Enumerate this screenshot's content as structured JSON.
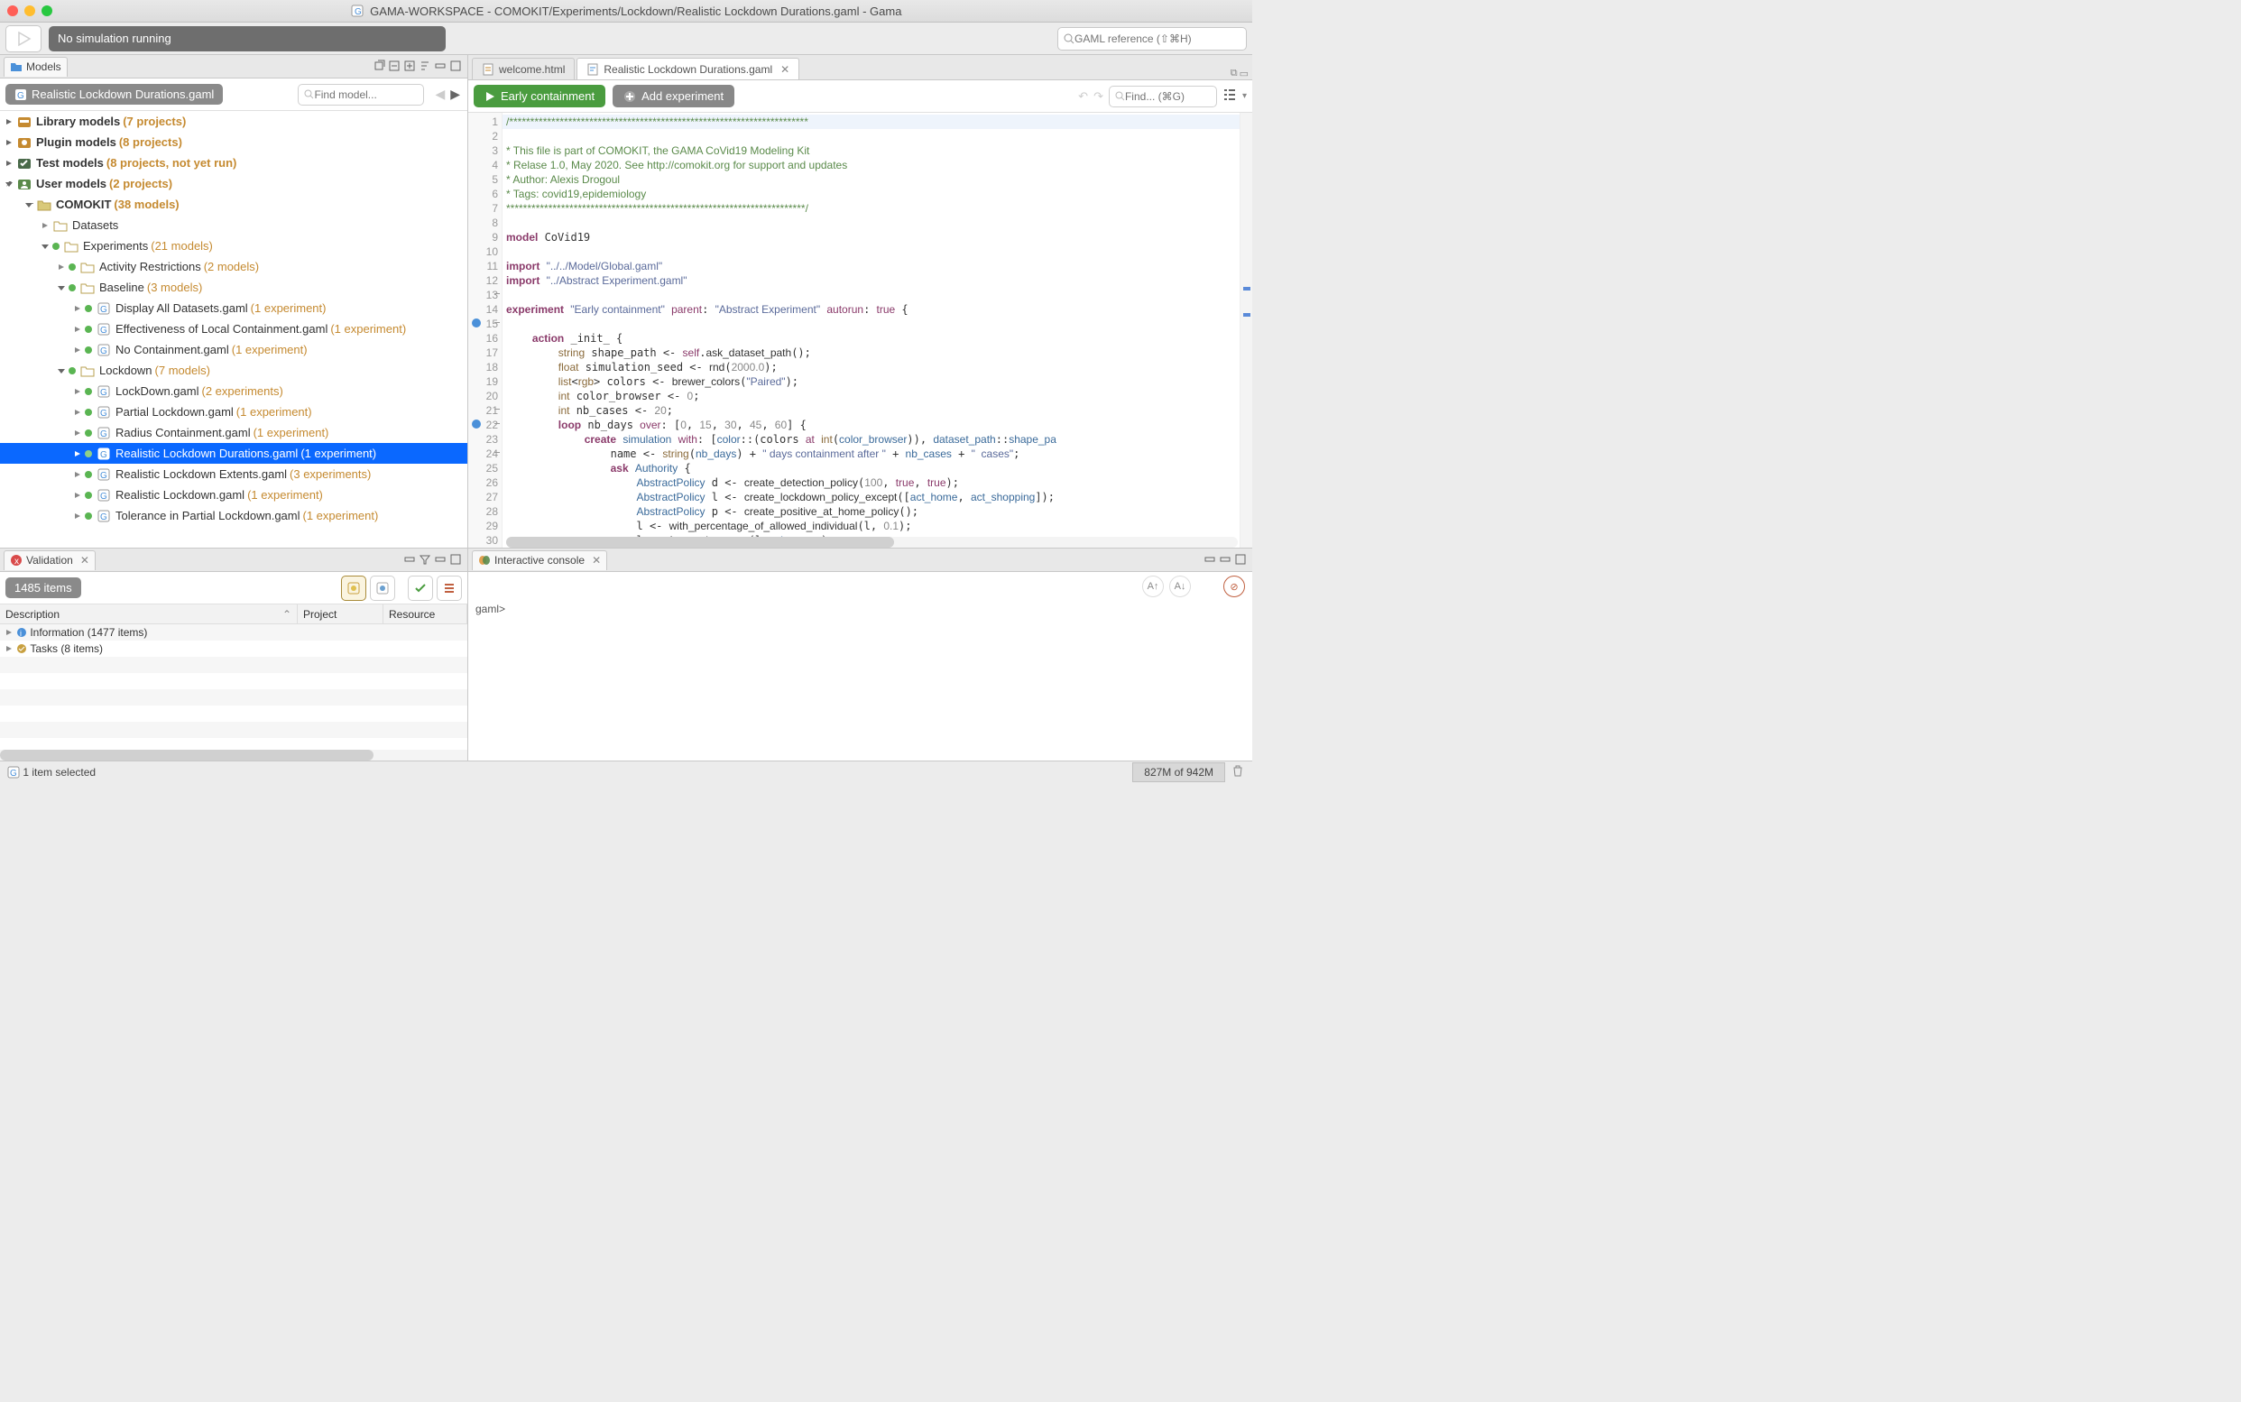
{
  "title": "GAMA-WORKSPACE - COMOKIT/Experiments/Lockdown/Realistic Lockdown Durations.gaml - Gama",
  "simStatus": "No simulation running",
  "searchPlaceholder": "GAML reference (⇧⌘H)",
  "modelsTab": "Models",
  "breadcrumb": "Realistic Lockdown Durations.gaml",
  "findModelPlaceholder": "Find model...",
  "tree": {
    "lib": {
      "label": "Library models",
      "count": "(7 projects)"
    },
    "plugin": {
      "label": "Plugin models",
      "count": "(8 projects)"
    },
    "test": {
      "label": "Test models",
      "count": "(8 projects, not yet run)"
    },
    "user": {
      "label": "User models",
      "count": "(2 projects)"
    },
    "comokit": {
      "label": "COMOKIT",
      "count": "(38 models)"
    },
    "datasets": {
      "label": "Datasets"
    },
    "experiments": {
      "label": "Experiments",
      "count": "(21 models)"
    },
    "activity": {
      "label": "Activity Restrictions",
      "count": "(2 models)"
    },
    "baseline": {
      "label": "Baseline",
      "count": "(3 models)"
    },
    "displayAll": {
      "label": "Display All Datasets.gaml",
      "count": "(1 experiment)"
    },
    "effectiveness": {
      "label": "Effectiveness of Local Containment.gaml",
      "count": "(1 experiment)"
    },
    "noContain": {
      "label": "No Containment.gaml",
      "count": "(1 experiment)"
    },
    "lockdown": {
      "label": "Lockdown",
      "count": "(7 models)"
    },
    "lockdownG": {
      "label": "LockDown.gaml",
      "count": "(2 experiments)"
    },
    "partial": {
      "label": "Partial Lockdown.gaml",
      "count": "(1 experiment)"
    },
    "radius": {
      "label": "Radius Containment.gaml",
      "count": "(1 experiment)"
    },
    "realisticDur": {
      "label": "Realistic Lockdown Durations.gaml",
      "count": "(1 experiment)"
    },
    "realisticExt": {
      "label": "Realistic Lockdown Extents.gaml",
      "count": "(3 experiments)"
    },
    "realistic": {
      "label": "Realistic Lockdown.gaml",
      "count": "(1 experiment)"
    },
    "tolerance": {
      "label": "Tolerance in Partial Lockdown.gaml",
      "count": "(1 experiment)"
    }
  },
  "editorTabs": {
    "welcome": "welcome.html",
    "file": "Realistic Lockdown Durations.gaml"
  },
  "runBtns": {
    "early": "Early containment",
    "add": "Add experiment"
  },
  "findPlaceholder": "Find... (⌘G)",
  "validation": {
    "tab": "Validation",
    "count": "1485 items",
    "cols": {
      "desc": "Description",
      "proj": "Project",
      "res": "Resource"
    },
    "info": "Information (1477 items)",
    "tasks": "Tasks (8 items)"
  },
  "console": {
    "tab": "Interactive console",
    "prompt": "gaml>"
  },
  "status": {
    "sel": "1 item selected",
    "mem": "827M of 942M"
  }
}
